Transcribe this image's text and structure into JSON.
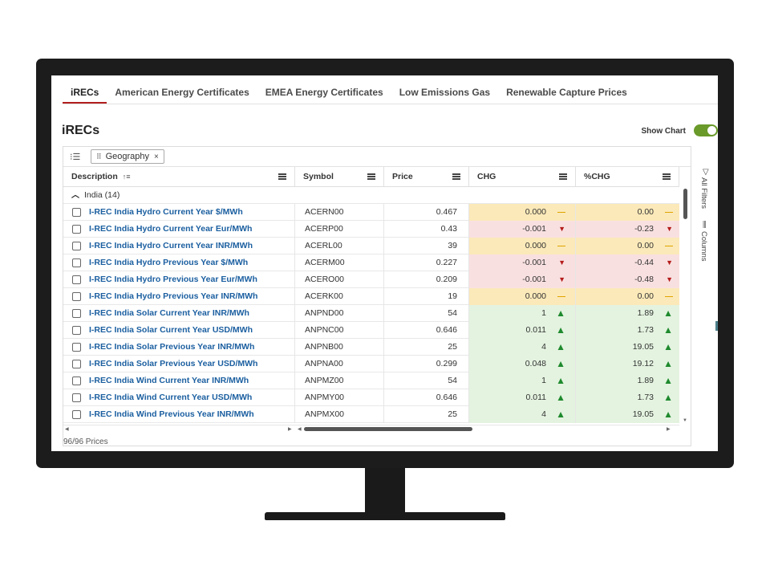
{
  "tabs": [
    {
      "label": "iRECs",
      "active": true
    },
    {
      "label": "American Energy Certificates",
      "active": false
    },
    {
      "label": "EMEA Energy Certificates",
      "active": false
    },
    {
      "label": "Low Emissions Gas",
      "active": false
    },
    {
      "label": "Renewable Capture Prices",
      "active": false
    }
  ],
  "page_title": "iRECs",
  "show_chart": {
    "label": "Show Chart",
    "on": true
  },
  "group_chip": {
    "label": "Geography",
    "close": "×"
  },
  "columns": {
    "description": "Description",
    "symbol": "Symbol",
    "price": "Price",
    "chg": "CHG",
    "pct_chg": "%CHG"
  },
  "group_row": "India (14)",
  "rows": [
    {
      "description": "I-REC India Hydro Current Year $/MWh",
      "symbol": "ACERN00",
      "price": "0.467",
      "chg": "0.000",
      "pct_chg": "0.00",
      "trend": "flat"
    },
    {
      "description": "I-REC India Hydro Current Year Eur/MWh",
      "symbol": "ACERP00",
      "price": "0.43",
      "chg": "-0.001",
      "pct_chg": "-0.23",
      "trend": "down"
    },
    {
      "description": "I-REC India Hydro Current Year INR/MWh",
      "symbol": "ACERL00",
      "price": "39",
      "chg": "0.000",
      "pct_chg": "0.00",
      "trend": "flat"
    },
    {
      "description": "I-REC India Hydro Previous Year $/MWh",
      "symbol": "ACERM00",
      "price": "0.227",
      "chg": "-0.001",
      "pct_chg": "-0.44",
      "trend": "down"
    },
    {
      "description": "I-REC India Hydro Previous Year Eur/MWh",
      "symbol": "ACERO00",
      "price": "0.209",
      "chg": "-0.001",
      "pct_chg": "-0.48",
      "trend": "down"
    },
    {
      "description": "I-REC India Hydro Previous Year INR/MWh",
      "symbol": "ACERK00",
      "price": "19",
      "chg": "0.000",
      "pct_chg": "0.00",
      "trend": "flat"
    },
    {
      "description": "I-REC India Solar Current Year INR/MWh",
      "symbol": "ANPND00",
      "price": "54",
      "chg": "1",
      "pct_chg": "1.89",
      "trend": "up"
    },
    {
      "description": "I-REC India Solar Current Year USD/MWh",
      "symbol": "ANPNC00",
      "price": "0.646",
      "chg": "0.011",
      "pct_chg": "1.73",
      "trend": "up"
    },
    {
      "description": "I-REC India Solar Previous Year INR/MWh",
      "symbol": "ANPNB00",
      "price": "25",
      "chg": "4",
      "pct_chg": "19.05",
      "trend": "up"
    },
    {
      "description": "I-REC India Solar Previous Year USD/MWh",
      "symbol": "ANPNA00",
      "price": "0.299",
      "chg": "0.048",
      "pct_chg": "19.12",
      "trend": "up"
    },
    {
      "description": "I-REC India Wind Current Year INR/MWh",
      "symbol": "ANPMZ00",
      "price": "54",
      "chg": "1",
      "pct_chg": "1.89",
      "trend": "up"
    },
    {
      "description": "I-REC India Wind Current Year USD/MWh",
      "symbol": "ANPMY00",
      "price": "0.646",
      "chg": "0.011",
      "pct_chg": "1.73",
      "trend": "up"
    },
    {
      "description": "I-REC India Wind Previous Year INR/MWh",
      "symbol": "ANPMX00",
      "price": "25",
      "chg": "4",
      "pct_chg": "19.05",
      "trend": "up"
    }
  ],
  "footer": "96/96 Prices",
  "side_panel": {
    "filters": "All Filters",
    "columns": "Columns"
  },
  "colors": {
    "accent_tab": "#b11e1e",
    "link": "#1b5fa0",
    "up": "#1f8a2e",
    "down": "#b51c1c",
    "flat": "#e0a400",
    "toggle": "#6a9a2a"
  }
}
